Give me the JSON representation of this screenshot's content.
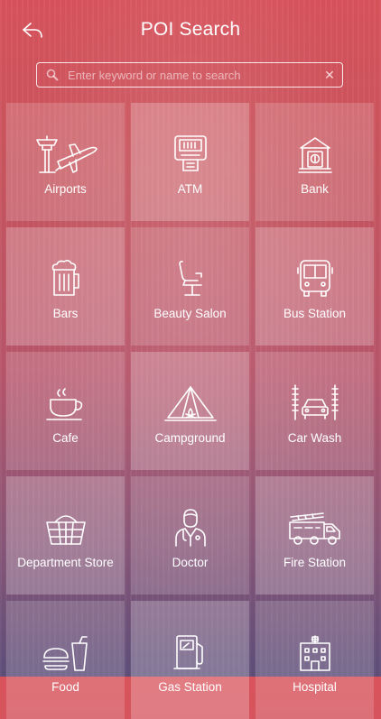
{
  "header": {
    "title": "POI Search",
    "back_icon": "back-arrow-icon"
  },
  "search": {
    "placeholder": "Enter keyword or name to search",
    "value": "",
    "search_icon": "search-icon",
    "clear_icon": "close-icon",
    "clear_glyph": "✕"
  },
  "categories": [
    {
      "label": "Airports",
      "icon": "airport-icon"
    },
    {
      "label": "ATM",
      "icon": "atm-icon"
    },
    {
      "label": "Bank",
      "icon": "bank-icon"
    },
    {
      "label": "Bars",
      "icon": "beer-icon"
    },
    {
      "label": "Beauty Salon",
      "icon": "salon-chair-icon"
    },
    {
      "label": "Bus Station",
      "icon": "bus-icon"
    },
    {
      "label": "Cafe",
      "icon": "coffee-cup-icon"
    },
    {
      "label": "Campground",
      "icon": "tent-icon"
    },
    {
      "label": "Car Wash",
      "icon": "car-wash-icon"
    },
    {
      "label": "Department Store",
      "icon": "shopping-basket-icon"
    },
    {
      "label": "Doctor",
      "icon": "doctor-icon"
    },
    {
      "label": "Fire Station",
      "icon": "fire-truck-icon"
    },
    {
      "label": "Food",
      "icon": "fast-food-icon"
    },
    {
      "label": "Gas Station",
      "icon": "fuel-pump-icon"
    },
    {
      "label": "Hospital",
      "icon": "hospital-icon"
    }
  ],
  "colors": {
    "gradient_top": "#d9535c",
    "gradient_bottom": "#5e4f7a",
    "tile_overlay": "rgba(255,255,255,0.17)"
  }
}
